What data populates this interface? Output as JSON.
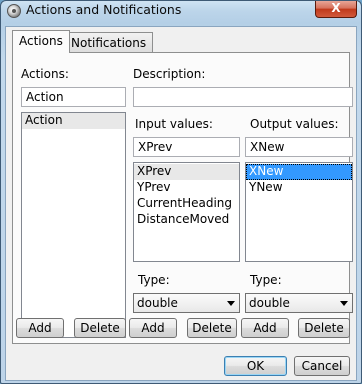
{
  "window": {
    "title": "Actions and Notifications",
    "close_label": "X"
  },
  "tabs": [
    {
      "label": "Actions",
      "active": true
    },
    {
      "label": "Notifications",
      "active": false
    }
  ],
  "actions": {
    "label": "Actions:",
    "name_value": "Action",
    "items": [
      "Action"
    ],
    "add_label": "Add",
    "delete_label": "Delete"
  },
  "description": {
    "label": "Description:",
    "value": ""
  },
  "input_values": {
    "label": "Input values:",
    "value": "XPrev",
    "items": [
      "XPrev",
      "YPrev",
      "CurrentHeading",
      "DistanceMoved"
    ],
    "type_label": "Type:",
    "type_value": "double",
    "add_label": "Add",
    "delete_label": "Delete"
  },
  "output_values": {
    "label": "Output values:",
    "value": "XNew",
    "items": [
      "XNew",
      "YNew"
    ],
    "type_label": "Type:",
    "type_value": "double",
    "add_label": "Add",
    "delete_label": "Delete"
  },
  "footer": {
    "ok_label": "OK",
    "cancel_label": "Cancel"
  },
  "colors": {
    "selection": "#3399ff",
    "close": "#c0391b"
  }
}
